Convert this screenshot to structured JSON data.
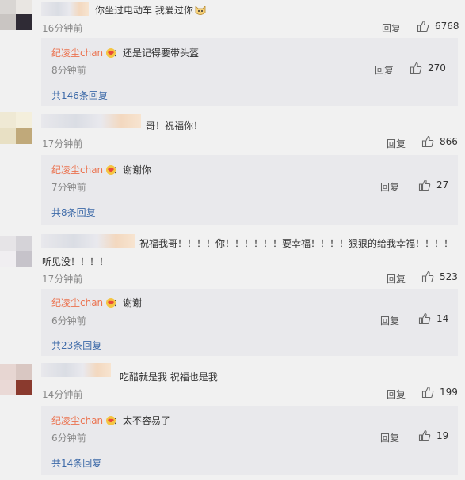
{
  "comments": [
    {
      "text": "你坐过电动车 我爱过你",
      "text2": "",
      "time": "16分钟前",
      "reply_label": "回复",
      "likes": "6768",
      "sub": {
        "name": "纪凌尘chan",
        "text": "：还是记得要带头盔",
        "time": "8分钟前",
        "reply_label": "回复",
        "likes": "270"
      },
      "more": "共146条回复"
    },
    {
      "text": "哥！祝福你！",
      "text2": "",
      "time": "17分钟前",
      "reply_label": "回复",
      "likes": "866",
      "sub": {
        "name": "纪凌尘chan",
        "text": "：谢谢你",
        "time": "7分钟前",
        "reply_label": "回复",
        "likes": "27"
      },
      "more": "共8条回复"
    },
    {
      "text": "祝福我哥！！！！你！！！！！！要幸福！！！！狠狠的给我幸福！！！！",
      "text2": "听见没！！！！",
      "time": "17分钟前",
      "reply_label": "回复",
      "likes": "523",
      "sub": {
        "name": "纪凌尘chan",
        "text": "：谢谢",
        "time": "6分钟前",
        "reply_label": "回复",
        "likes": "14"
      },
      "more": "共23条回复"
    },
    {
      "text": "吃醋就是我 祝福也是我",
      "text2": "",
      "time": "14分钟前",
      "reply_label": "回复",
      "likes": "199",
      "sub": {
        "name": "纪凌尘chan",
        "text": "：太不容易了",
        "time": "6分钟前",
        "reply_label": "回复",
        "likes": "19"
      },
      "more": "共14条回复"
    }
  ],
  "icons": {
    "like": "thumbs-up-icon",
    "badge": "vip-badge-icon",
    "emoji": "cat-emoji-icon"
  },
  "colors": {
    "name": "#eb7350",
    "link": "#3d6aa8",
    "muted": "#888888"
  }
}
